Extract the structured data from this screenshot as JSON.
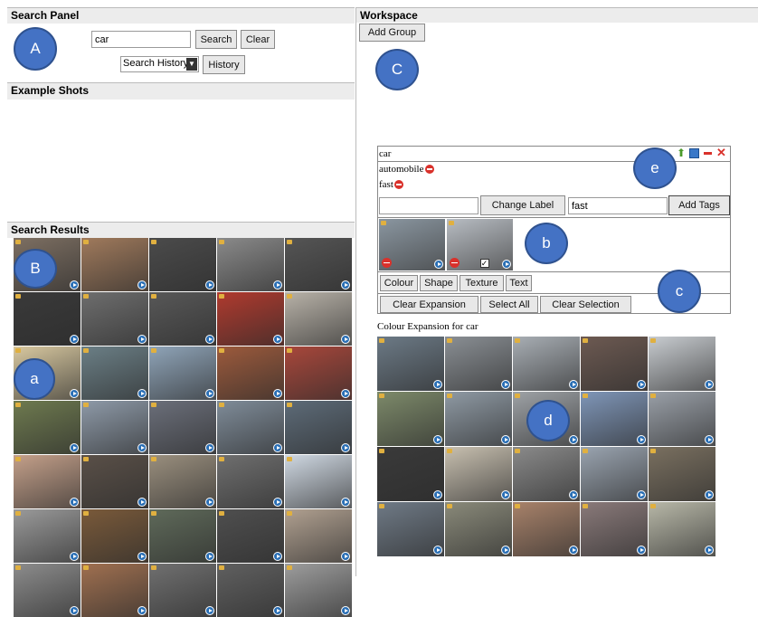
{
  "search_panel": {
    "title": "Search Panel",
    "query_value": "car",
    "search_label": "Search",
    "clear_label": "Clear",
    "history_select": "Search History",
    "history_label": "History"
  },
  "example_shots": {
    "title": "Example Shots"
  },
  "search_results": {
    "title": "Search Results",
    "thumbs": [
      "#7d6f62",
      "#a07a5c",
      "#4b4b4b",
      "#8a8a8a",
      "#555555",
      "#3a3a3a",
      "#6e6e6e",
      "#585858",
      "#b03a2e",
      "#b8b2a8",
      "#d8c8a0",
      "#6b7f86",
      "#8fa4b8",
      "#9c5a3c",
      "#a8473b",
      "#6e7a4f",
      "#8e9aa8",
      "#6b6f7a",
      "#7f8c99",
      "#5d6b78",
      "#c4a08a",
      "#5a5048",
      "#9a8f7e",
      "#6f6f6f",
      "#cfd8e2",
      "#9a9a9a",
      "#7a5a3a",
      "#5f6a5a",
      "#4f4f4f",
      "#b0a090",
      "#8c8c8c",
      "#a07050",
      "#707070",
      "#606060",
      "#9d9d9d"
    ]
  },
  "workspace": {
    "title": "Workspace",
    "add_group_label": "Add Group",
    "group": {
      "label": "car",
      "tags": [
        "automobile",
        "fast"
      ],
      "label_input_value": "",
      "change_label_button": "Change Label",
      "tag_input_value": "fast",
      "add_tags_button": "Add Tags",
      "shots": [
        "#8a96a0",
        "#b7bcc2"
      ],
      "feature_tabs": [
        "Colour",
        "Shape",
        "Texture",
        "Text"
      ],
      "clear_expansion_button": "Clear Expansion",
      "select_all_button": "Select All",
      "clear_selection_button": "Clear Selection"
    },
    "expansion": {
      "title": "Colour Expansion for car",
      "thumbs": [
        "#6c7a86",
        "#8a8f94",
        "#a8aeb4",
        "#6d5a52",
        "#c8ccd0",
        "#7d8a6a",
        "#8f9aa4",
        "#9ea2a6",
        "#7f96b8",
        "#9aa0a8",
        "#3a3a3a",
        "#c8c0b0",
        "#8a8a8a",
        "#9aa4b0",
        "#7a7060",
        "#6f7a86",
        "#8a8a7a",
        "#a8826a",
        "#8a7a7a",
        "#b8b8a8"
      ]
    }
  },
  "markers": {
    "A": "A",
    "B": "B",
    "C": "C",
    "a": "a",
    "b": "b",
    "c": "c",
    "d": "d",
    "e": "e"
  },
  "colors": {
    "marker_fill": "#4472c4",
    "panel_header": "#ececec",
    "remove_red": "#d9312b"
  }
}
